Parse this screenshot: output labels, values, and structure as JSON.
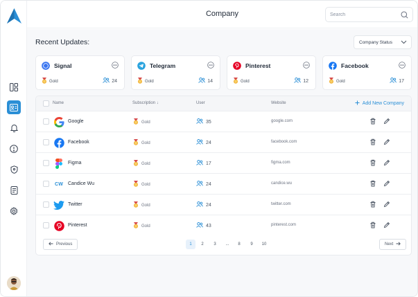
{
  "header": {
    "title": "Company",
    "search_placeholder": "Search"
  },
  "sidebar": {
    "items": [
      {
        "name": "dashboard-icon"
      },
      {
        "name": "contact-card-icon",
        "active": true
      },
      {
        "name": "bell-icon"
      },
      {
        "name": "alert-icon"
      },
      {
        "name": "shield-icon"
      },
      {
        "name": "document-icon"
      },
      {
        "name": "gear-icon"
      }
    ]
  },
  "section": {
    "title": "Recent Updates:",
    "filter_label": "Company Status"
  },
  "cards": [
    {
      "name": "Signal",
      "tier": "Gold",
      "users": "24",
      "brand": "signal-logo-icon"
    },
    {
      "name": "Telegram",
      "tier": "Gold",
      "users": "14",
      "brand": "telegram-logo-icon"
    },
    {
      "name": "Pinterest",
      "tier": "Gold",
      "users": "12",
      "brand": "pinterest-logo-icon"
    },
    {
      "name": "Facebook",
      "tier": "Gold",
      "users": "17",
      "brand": "facebook-logo-icon"
    }
  ],
  "table": {
    "columns": [
      "Name",
      "Subscription",
      "User",
      "Website"
    ],
    "sort_arrow": "↓",
    "add_label": "Add New Company",
    "rows": [
      {
        "name": "Google",
        "tier": "Gold",
        "users": "35",
        "site": "google.com",
        "logo": "google-logo-icon"
      },
      {
        "name": "Facebook",
        "tier": "Gold",
        "users": "24",
        "site": "facebook.com",
        "logo": "facebook-logo-icon"
      },
      {
        "name": "Figma",
        "tier": "Gold",
        "users": "17",
        "site": "figma.com",
        "logo": "figma-logo-icon"
      },
      {
        "name": "Candice Wu",
        "tier": "Gold",
        "users": "24",
        "site": "candice.wu",
        "logo": "initials-badge",
        "initials": "CW"
      },
      {
        "name": "Twitter",
        "tier": "Gold",
        "users": "24",
        "site": "twitter.com",
        "logo": "twitter-logo-icon"
      },
      {
        "name": "Pinterest",
        "tier": "Gold",
        "users": "43",
        "site": "pinterest.com",
        "logo": "pinterest-logo-icon"
      }
    ]
  },
  "pagination": {
    "previous": "Previous",
    "next": "Next",
    "pages": [
      "1",
      "2",
      "3",
      "...",
      "8",
      "9",
      "10"
    ],
    "current": "1"
  },
  "colors": {
    "accent": "#2b8fd6",
    "background": "#f7f8fa"
  }
}
